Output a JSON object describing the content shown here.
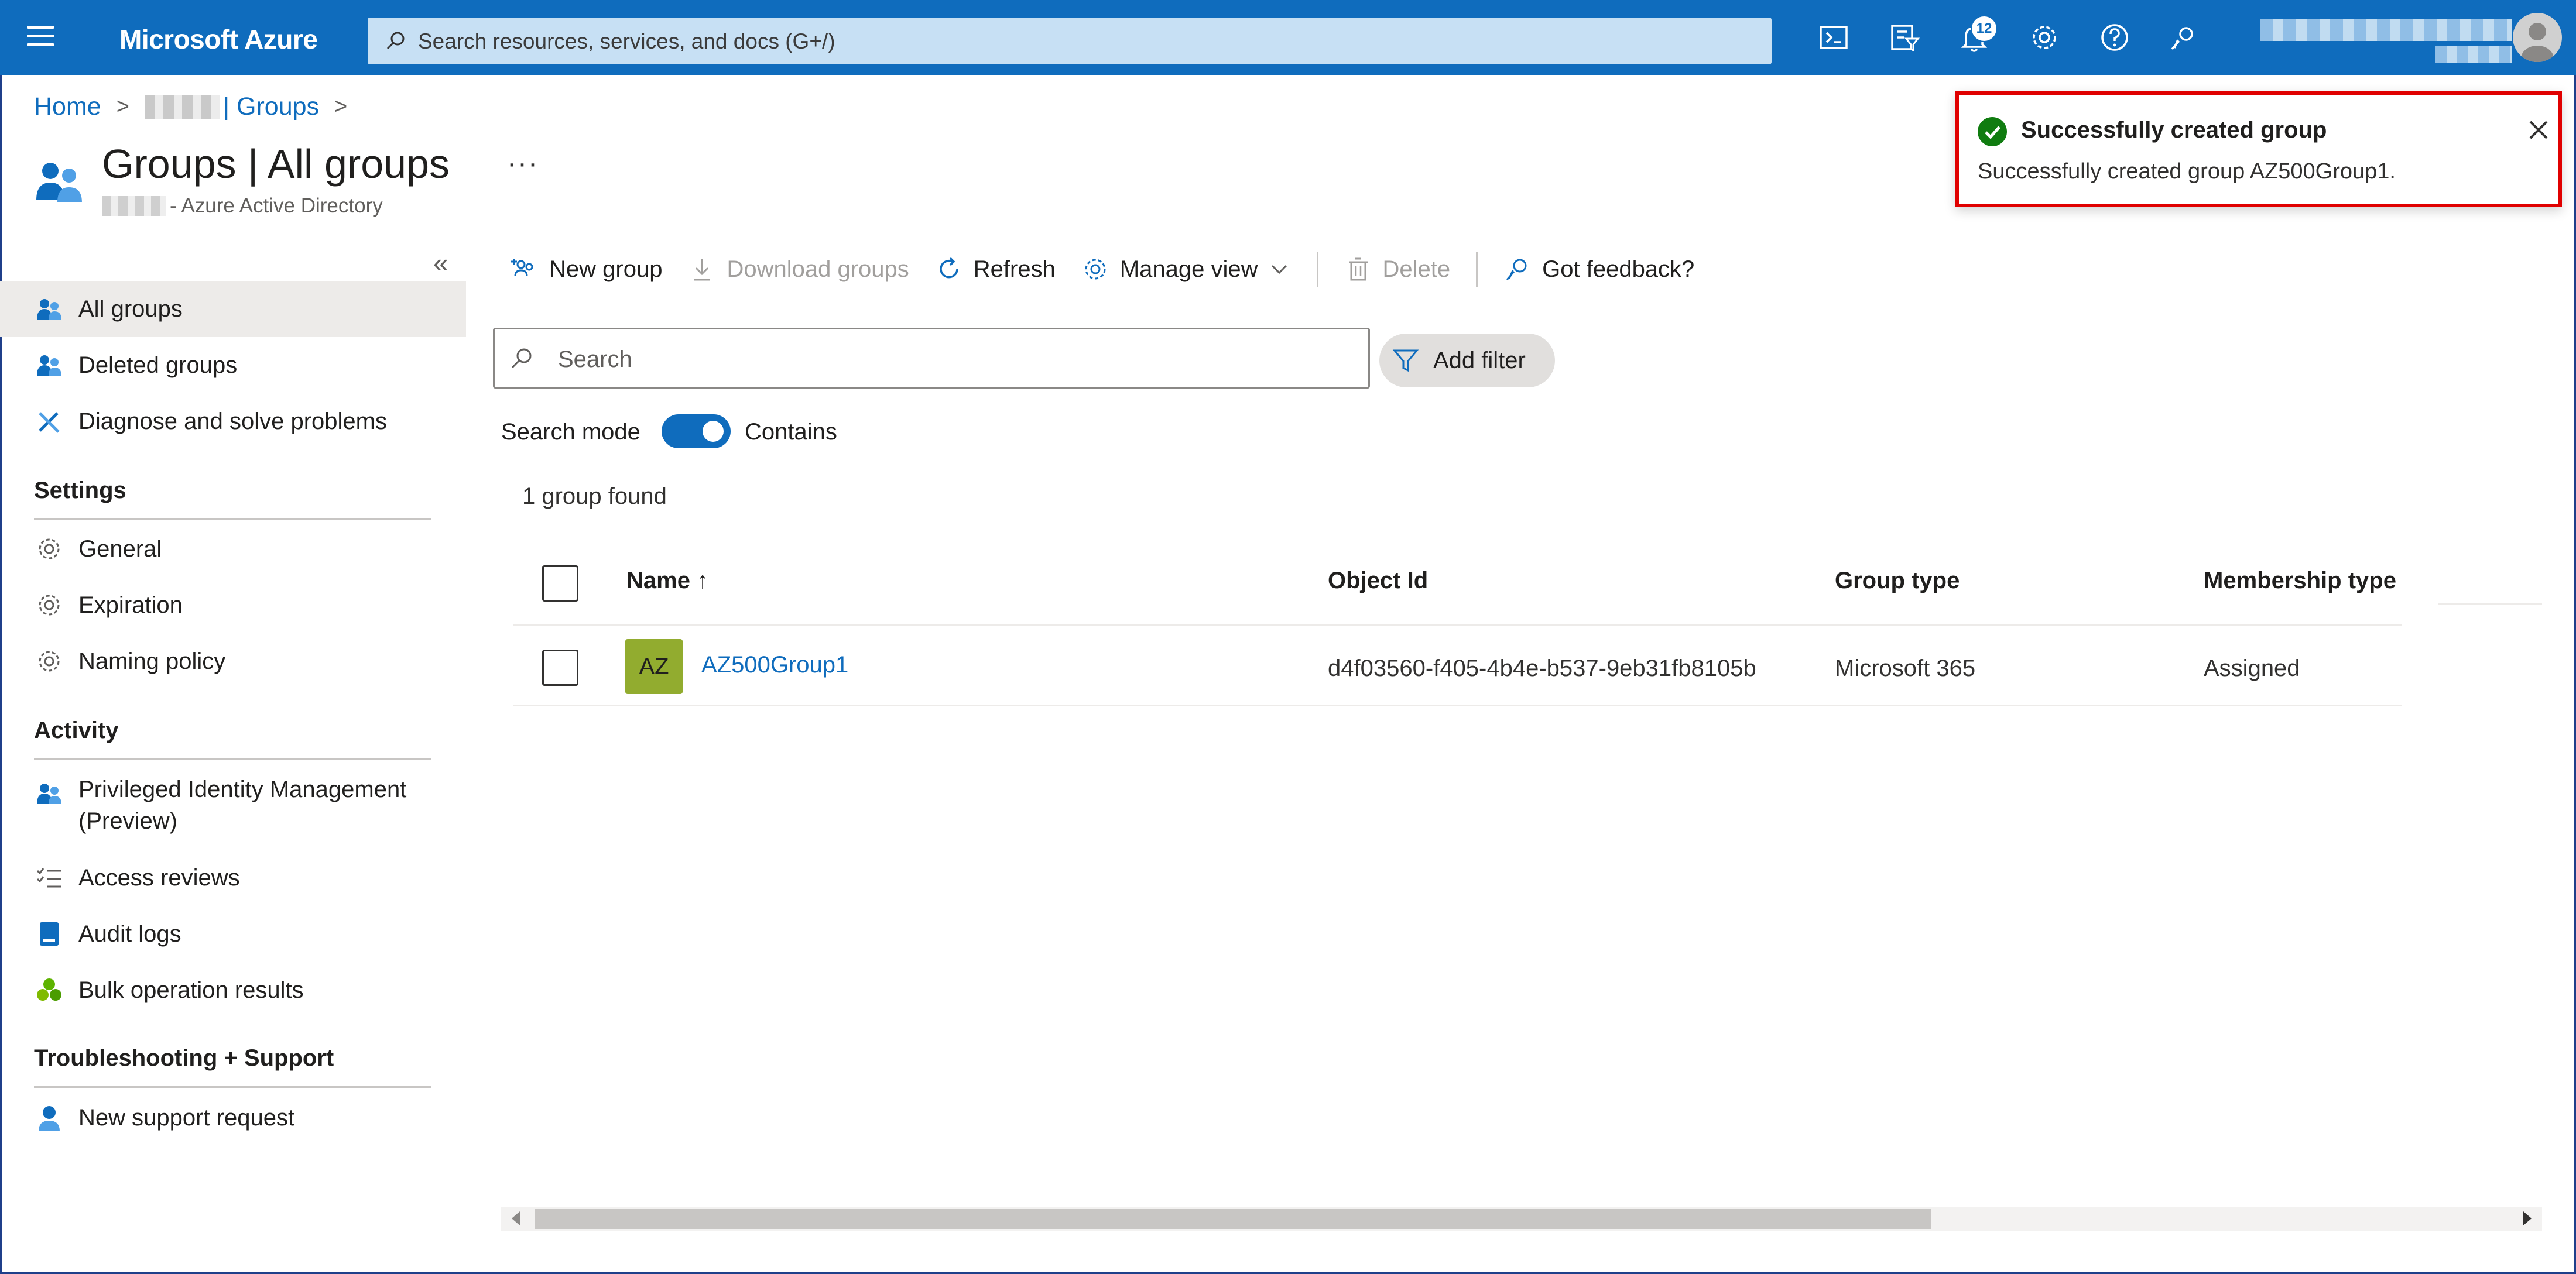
{
  "topbar": {
    "brand": "Microsoft Azure",
    "search_placeholder": "Search resources, services, and docs (G+/)",
    "notifications_count": "12",
    "icons": [
      "cloud-shell-icon",
      "directory-filter-icon",
      "notifications-icon",
      "settings-icon",
      "help-icon",
      "feedback-icon"
    ]
  },
  "breadcrumb": {
    "home": "Home",
    "groups": "| Groups"
  },
  "page": {
    "title": "Groups | All groups",
    "subtitle": "- Azure Active Directory",
    "more": "···"
  },
  "toast": {
    "title": "Successfully created group",
    "message": "Successfully created group AZ500Group1."
  },
  "sidebar": {
    "collapse": "«",
    "items": [
      {
        "label": "All groups"
      },
      {
        "label": "Deleted groups"
      },
      {
        "label": "Diagnose and solve problems"
      }
    ],
    "settings_header": "Settings",
    "settings_items": [
      {
        "label": "General"
      },
      {
        "label": "Expiration"
      },
      {
        "label": "Naming policy"
      }
    ],
    "activity_header": "Activity",
    "activity_items": [
      {
        "label": "Privileged Identity Management",
        "label2": "(Preview)"
      },
      {
        "label": "Access reviews"
      },
      {
        "label": "Audit logs"
      },
      {
        "label": "Bulk operation results"
      }
    ],
    "support_header": "Troubleshooting + Support",
    "support_items": [
      {
        "label": "New support request"
      }
    ]
  },
  "toolbar": {
    "new_group": "New group",
    "download_groups": "Download groups",
    "refresh": "Refresh",
    "manage_view": "Manage view",
    "delete": "Delete",
    "feedback": "Got feedback?"
  },
  "filter": {
    "search_placeholder": "Search",
    "add_filter": "Add filter",
    "search_mode_label": "Search mode",
    "search_mode_value": "Contains",
    "search_mode_on": true
  },
  "results": {
    "count_text": "1 group found"
  },
  "table": {
    "columns": [
      "Name ↑",
      "Object Id",
      "Group type",
      "Membership type"
    ],
    "rows": [
      {
        "initials": "AZ",
        "name": "AZ500Group1",
        "object_id": "d4f03560-f405-4b4e-b537-9eb31fb8105b",
        "group_type": "Microsoft 365",
        "membership_type": "Assigned"
      }
    ]
  },
  "colors": {
    "azure_blue": "#0f6cbd",
    "toast_border": "#e00000",
    "success_green": "#107c10",
    "group_avatar": "#92ac2f"
  }
}
